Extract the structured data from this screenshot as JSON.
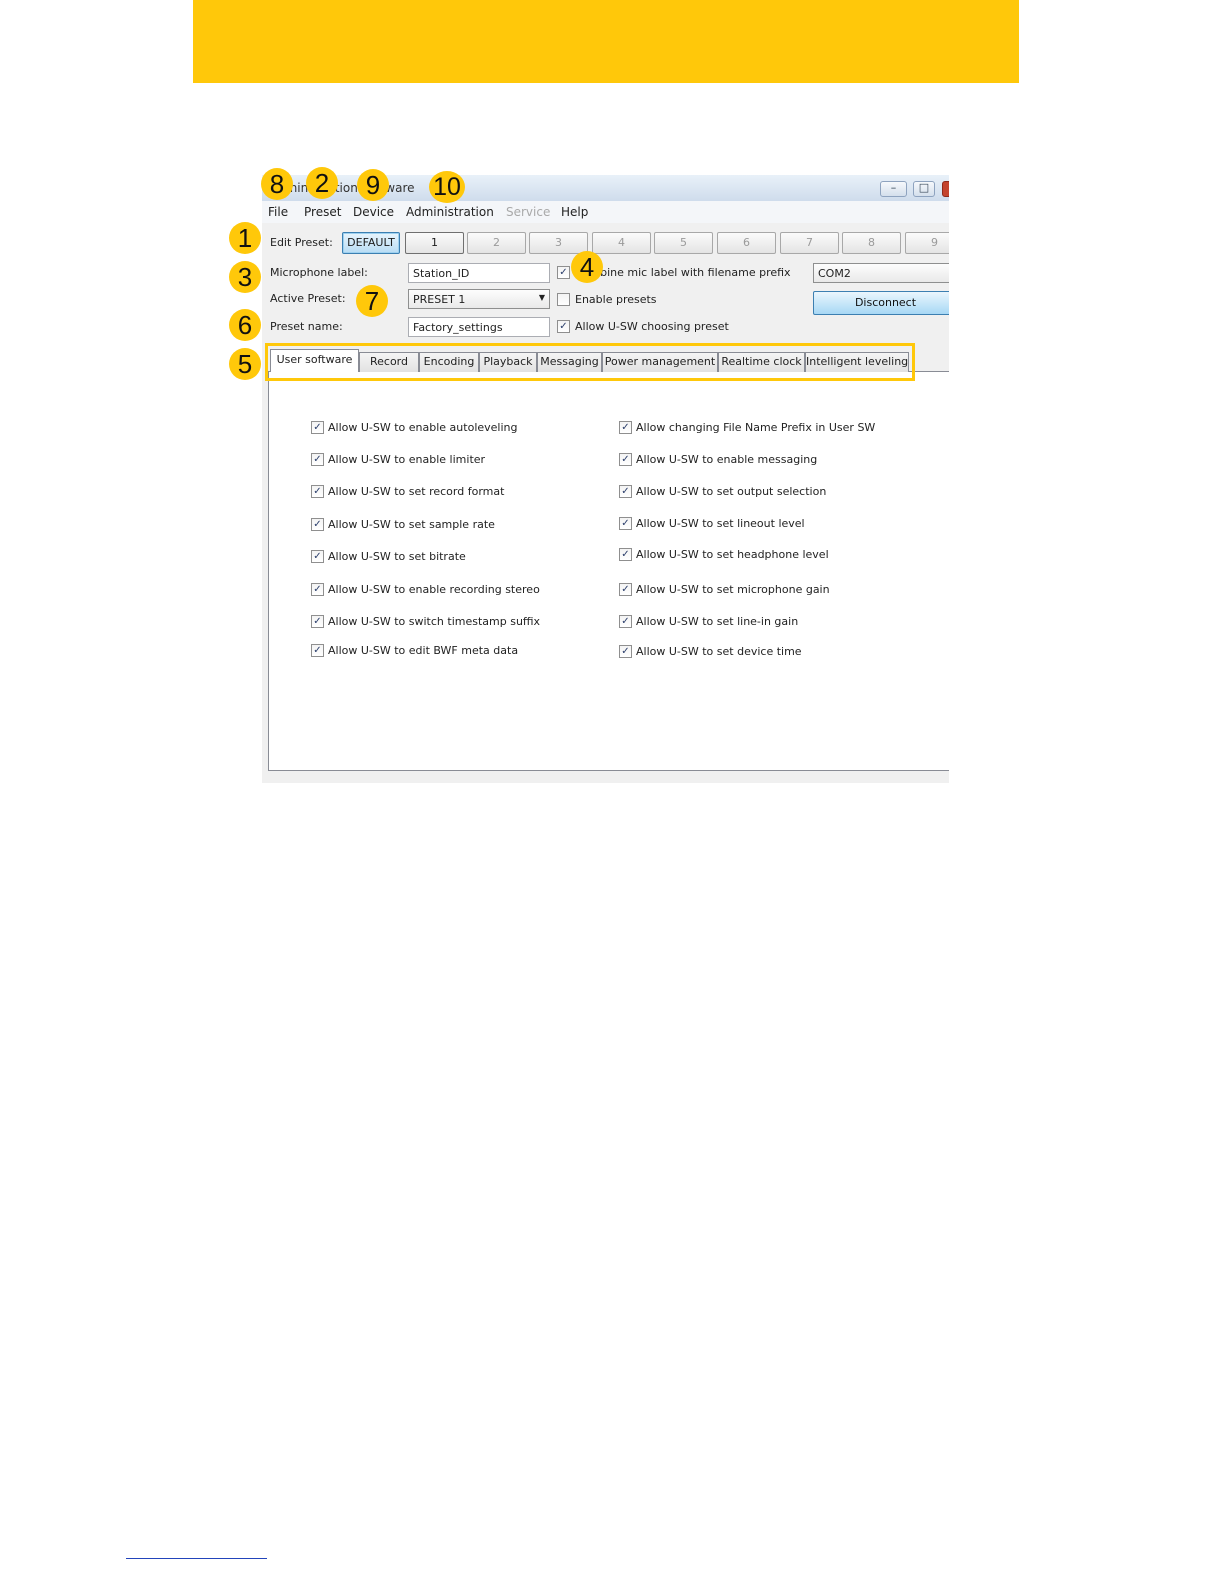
{
  "window": {
    "title": "Administration Software",
    "controls": {
      "minimize": "–",
      "maximize": "□",
      "close": "×"
    }
  },
  "menu": {
    "items": [
      "File",
      "Preset",
      "Device",
      "Administration",
      "Service",
      "Help"
    ],
    "disabled": [
      "Service"
    ]
  },
  "form": {
    "edit_preset_label": "Edit Preset:",
    "preset_buttons": [
      "DEFAULT",
      "1",
      "2",
      "3",
      "4",
      "5",
      "6",
      "7",
      "8",
      "9"
    ],
    "microphone_label_label": "Microphone label:",
    "microphone_label_value": "Station_ID",
    "active_preset_label": "Active Preset:",
    "active_preset_value": "PRESET 1",
    "preset_name_label": "Preset name:",
    "preset_name_value": "Factory_settings",
    "combine_label": "Combine mic label with filename prefix",
    "combine_checked": true,
    "enable_presets_label": "Enable presets",
    "enable_presets_checked": false,
    "allow_choosing_label": "Allow U-SW choosing preset",
    "allow_choosing_checked": true,
    "port_value": "COM2",
    "disconnect_label": "Disconnect"
  },
  "tabs": [
    "User software",
    "Record",
    "Encoding",
    "Playback",
    "Messaging",
    "Power management",
    "Realtime clock",
    "Intelligent leveling"
  ],
  "selected_tab": "User software",
  "options_left": [
    "Allow U-SW to enable autoleveling",
    "Allow U-SW to enable limiter",
    "Allow U-SW to set record format",
    "Allow U-SW to set sample rate",
    "Allow U-SW to set bitrate",
    "Allow U-SW to enable recording stereo",
    "Allow U-SW to switch timestamp suffix",
    "Allow U-SW to edit BWF meta data"
  ],
  "options_right": [
    "Allow changing File Name Prefix in User SW",
    "Allow U-SW to enable messaging",
    "Allow U-SW to set output selection",
    "Allow U-SW to set lineout level",
    "Allow U-SW to set headphone level",
    "Allow U-SW to set microphone gain",
    "Allow U-SW to set line-in gain",
    "Allow U-SW to set device time"
  ],
  "check_mark": "✓",
  "callouts": {
    "b1": "1",
    "b2": "2",
    "b3": "3",
    "b4": "4",
    "b5": "5",
    "b6": "6",
    "b7": "7",
    "b8": "8",
    "b9": "9",
    "b10": "10"
  },
  "colors": {
    "accent": "#ffc80a",
    "button_blue": "#a7d8f5"
  }
}
